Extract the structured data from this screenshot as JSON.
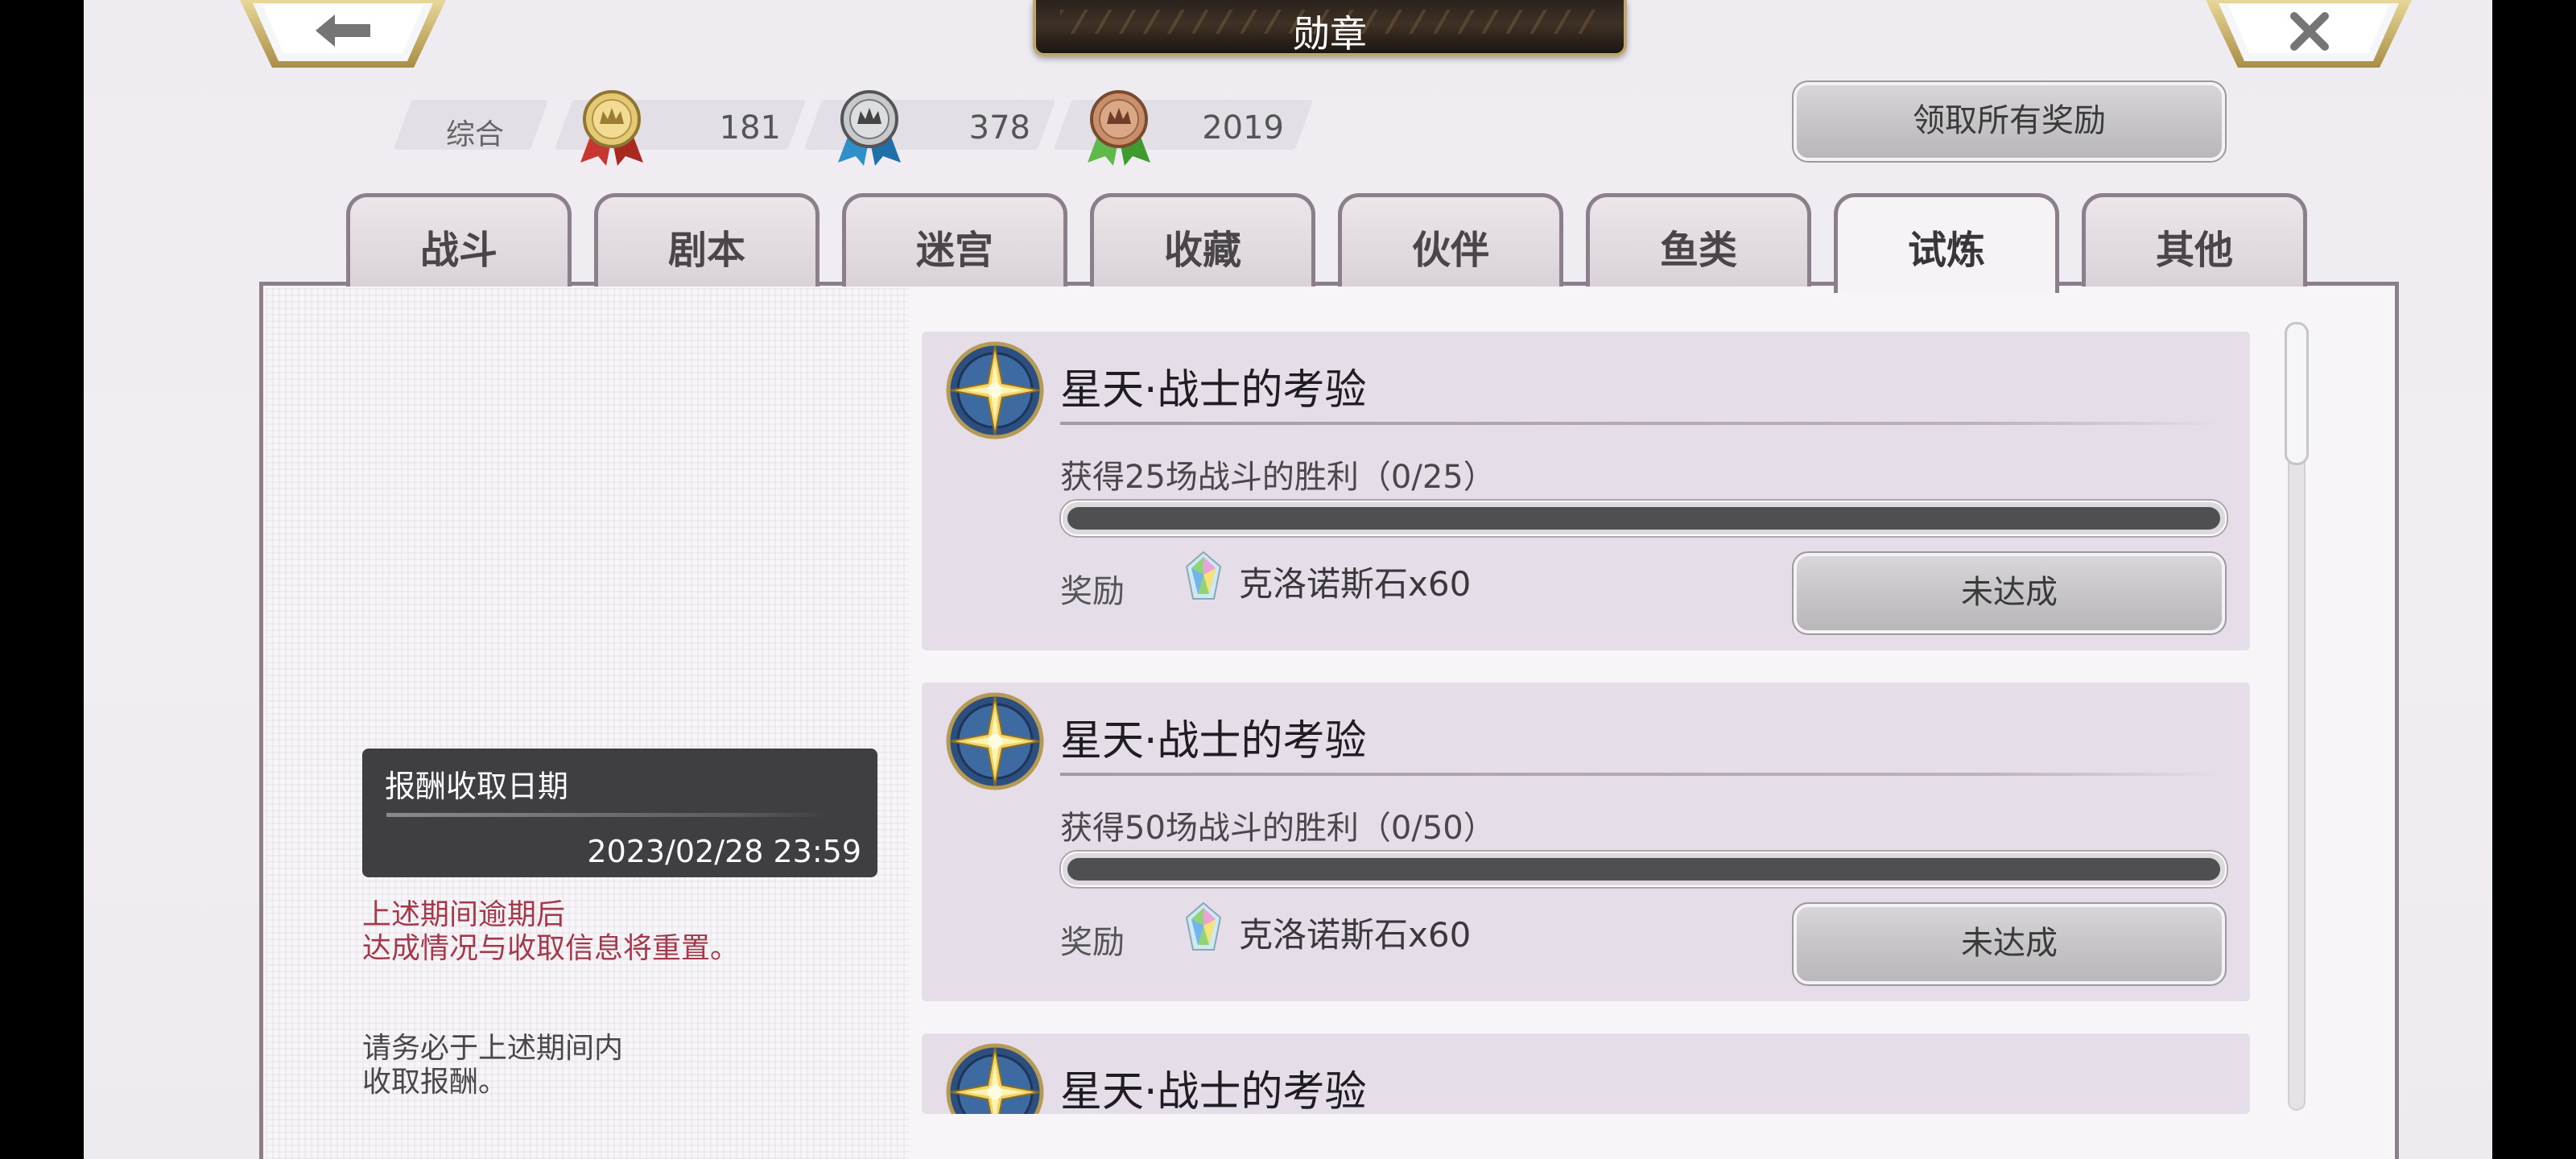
{
  "header": {
    "title": "勋章",
    "back_icon": "arrow-left-icon",
    "close_icon": "close-x-icon"
  },
  "medal_counts": {
    "overall_label": "综合",
    "gold": "181",
    "silver": "378",
    "bronze": "2019"
  },
  "claim_all_label": "领取所有奖励",
  "tabs": [
    {
      "label": "战斗"
    },
    {
      "label": "剧本"
    },
    {
      "label": "迷宫"
    },
    {
      "label": "收藏"
    },
    {
      "label": "伙伴"
    },
    {
      "label": "鱼类"
    },
    {
      "label": "试炼",
      "active": true
    },
    {
      "label": "其他"
    }
  ],
  "sidebar": {
    "date_label": "报酬收取日期",
    "date_value": "2023/02/28 23:59",
    "warning_line1": "上述期间逾期后",
    "warning_line2": "达成情况与收取信息将重置。",
    "note_line1": "请务必于上述期间内",
    "note_line2": "收取报酬。"
  },
  "quests": [
    {
      "title": "星天·战士的考验",
      "description": "获得25场战斗的胜利（0/25）",
      "progress": 0,
      "reward_label": "奖励",
      "reward_item": "克洛诺斯石x60",
      "status": "未达成"
    },
    {
      "title": "星天·战士的考验",
      "description": "获得50场战斗的胜利（0/50）",
      "progress": 0,
      "reward_label": "奖励",
      "reward_item": "克洛诺斯石x60",
      "status": "未达成"
    },
    {
      "title": "星天·战士的考验"
    }
  ],
  "colors": {
    "warning_text": "#a33a4b",
    "tab_border": "#8a7f8a",
    "card_bg": "#e5dde7"
  }
}
